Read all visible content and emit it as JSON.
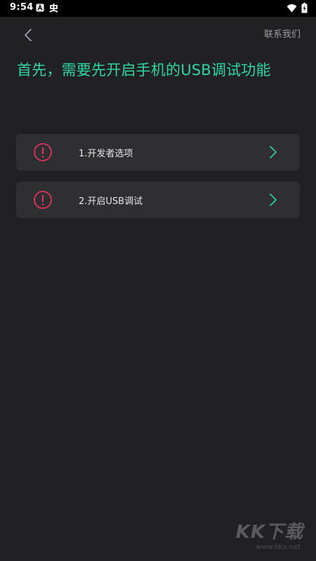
{
  "status_bar": {
    "time": "9:54",
    "icons": [
      "notification-a-icon",
      "app-bug-icon",
      "wifi-icon",
      "battery-charging-icon"
    ]
  },
  "header": {
    "back_icon": "chevron-left-icon",
    "contact_label": "联系我们"
  },
  "title": "首先，需要先开启手机的USB调试功能",
  "steps": [
    {
      "label": "1.开发者选项",
      "icon": "warning-circle-icon"
    },
    {
      "label": "2.开启USB调试",
      "icon": "warning-circle-icon"
    }
  ],
  "watermark": {
    "logo": "KK下载",
    "url": "www.kkx.net"
  },
  "colors": {
    "background": "#212125",
    "card": "#2e2e33",
    "accent_green": "#2fd6a0",
    "warning_red": "#e0345c",
    "chevron_green": "#2fc99a"
  }
}
